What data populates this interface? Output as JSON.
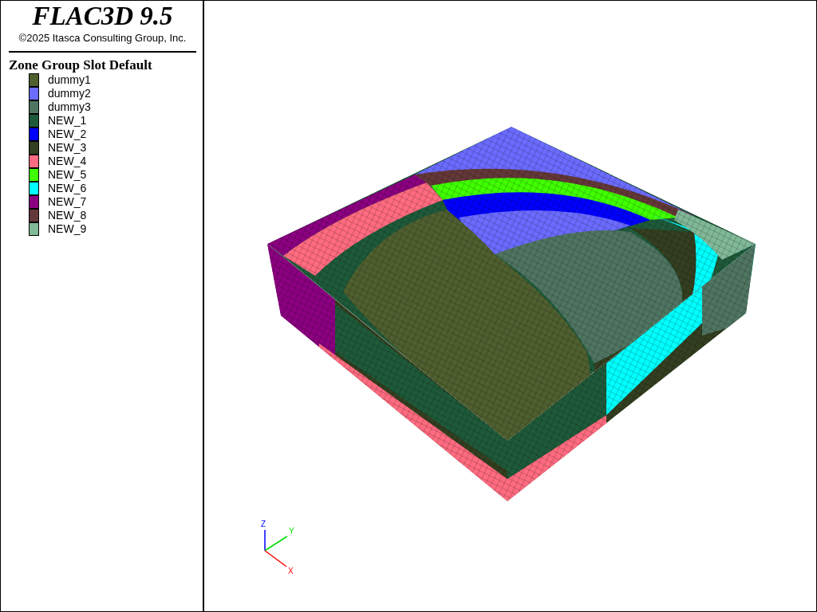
{
  "header": {
    "title": "FLAC3D 9.5",
    "copyright": "©2025 Itasca Consulting Group, Inc."
  },
  "legend": {
    "title": "Zone Group Slot Default",
    "items": [
      {
        "label": "dummy1",
        "color": "#4f5f2f"
      },
      {
        "label": "dummy2",
        "color": "#6b6bff"
      },
      {
        "label": "dummy3",
        "color": "#4f7562"
      },
      {
        "label": "NEW_1",
        "color": "#1e5a3a"
      },
      {
        "label": "NEW_2",
        "color": "#0000ff"
      },
      {
        "label": "NEW_3",
        "color": "#333f20"
      },
      {
        "label": "NEW_4",
        "color": "#ff6b80"
      },
      {
        "label": "NEW_5",
        "color": "#40ff00"
      },
      {
        "label": "NEW_6",
        "color": "#00ffff"
      },
      {
        "label": "NEW_7",
        "color": "#8b0080"
      },
      {
        "label": "NEW_8",
        "color": "#643838"
      },
      {
        "label": "NEW_9",
        "color": "#80b898"
      }
    ]
  },
  "axes": [
    {
      "label": "Z"
    },
    {
      "label": "Y"
    },
    {
      "label": "X"
    }
  ]
}
